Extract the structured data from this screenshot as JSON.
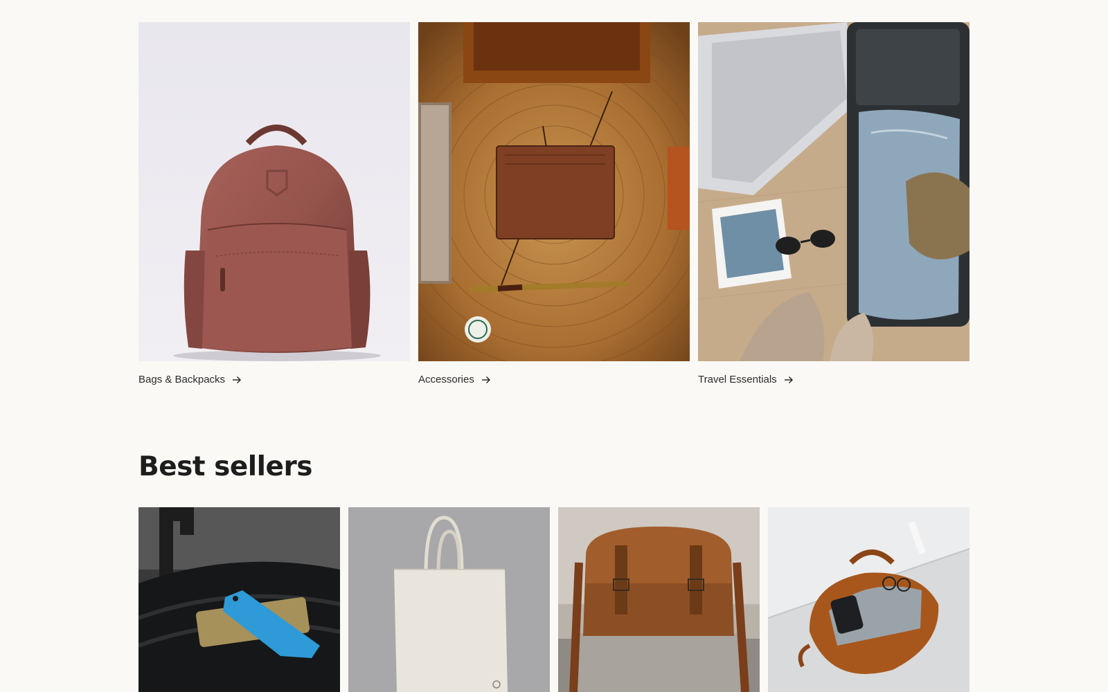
{
  "collections": [
    {
      "label": "Bags & Backpacks",
      "image_alt": "Leather backpack",
      "arrow_icon": "arrow-right-icon"
    },
    {
      "label": "Accessories",
      "image_alt": "Leather wallet on wooden stump with pen",
      "arrow_icon": "arrow-right-icon"
    },
    {
      "label": "Travel Essentials",
      "image_alt": "Open suitcase with laptop, jeans and sunglasses",
      "arrow_icon": "arrow-right-icon"
    }
  ],
  "best_sellers": {
    "title": "Best sellers",
    "products": [
      {
        "image_alt": "Black suitcase with blue luggage tag"
      },
      {
        "image_alt": "Canvas tote bag"
      },
      {
        "image_alt": "Brown leather messenger bag"
      },
      {
        "image_alt": "Tan leather duffel bag with laptop"
      }
    ]
  },
  "colors": {
    "page_background": "#faf9f6",
    "text": "#1f1f1f"
  }
}
